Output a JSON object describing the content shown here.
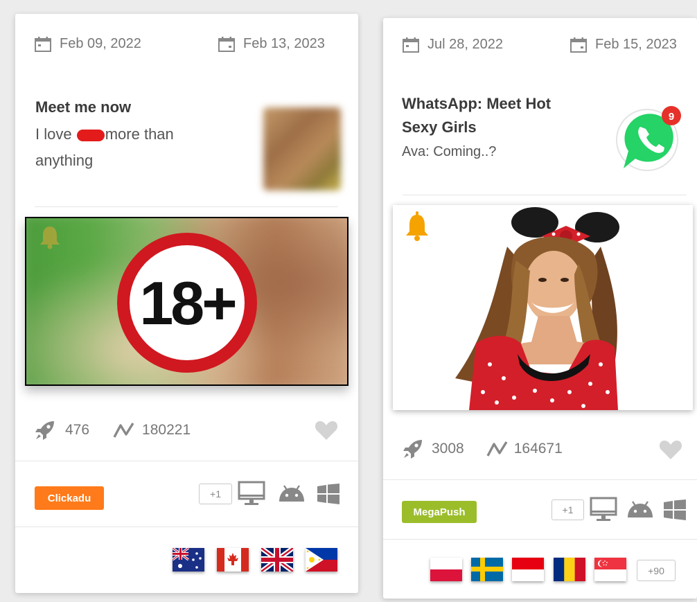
{
  "cards": [
    {
      "created_date": "Feb 09, 2022",
      "last_seen_date": "Feb 13, 2023",
      "title": "Meet me now",
      "body_before": "I love",
      "body_after": "more than",
      "body_line2": "anything",
      "overlay_label": "18+",
      "impressions": "476",
      "trend_value": "180221",
      "network": "Clickadu",
      "network_color": "#ff7a1a",
      "platforms_extra": "+1",
      "platforms": [
        "desktop-icon",
        "android-icon",
        "windows-icon"
      ],
      "countries": [
        "Australia",
        "Canada",
        "United Kingdom",
        "Philippines"
      ]
    },
    {
      "created_date": "Jul 28, 2022",
      "last_seen_date": "Feb 15, 2023",
      "title_line1": "WhatsApp: Meet Hot",
      "title_line2": "Sexy Girls",
      "body": "Ava: Coming..?",
      "icon_badge_count": "9",
      "impressions": "3008",
      "trend_value": "164671",
      "network": "MegaPush",
      "network_color": "#9bbd2a",
      "platforms_extra": "+1",
      "platforms": [
        "desktop-icon",
        "android-icon",
        "windows-icon"
      ],
      "countries": [
        "Poland",
        "Sweden",
        "Indonesia",
        "Romania",
        "Singapore"
      ],
      "countries_extra": "+90"
    }
  ],
  "colors": {
    "accent_orange": "#ff7a1a",
    "accent_green": "#9bbd2a",
    "bell": "#f5a300",
    "whatsapp_green": "#25d366",
    "age_ring": "#d01820"
  }
}
